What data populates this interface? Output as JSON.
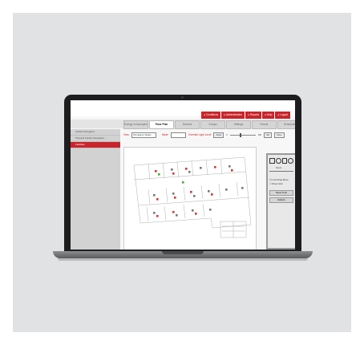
{
  "menu": [
    {
      "icon": "lock-icon",
      "label": "Conditions"
    },
    {
      "icon": "gear-icon",
      "label": "Administration"
    },
    {
      "icon": "report-icon",
      "label": "Reports"
    },
    {
      "icon": "help-icon",
      "label": "Help"
    },
    {
      "icon": "logout-icon",
      "label": "Logout"
    }
  ],
  "tabs": [
    "Energy Consumption",
    "Floor Plan",
    "Devices",
    "Groups",
    "Settings",
    "Events",
    "Schedules"
  ],
  "active_tab_index": 1,
  "sidebar": [
    "Facility Navigation",
    "Physical Facility Navigation",
    "Facilities"
  ],
  "toolbar": {
    "view_label": "View",
    "view_value": "Occupancy Status",
    "mode_label": "Mode",
    "light_label": "Override Light Level",
    "apply": "Apply",
    "slider_min": "0",
    "slider_max": "100",
    "set": "Set",
    "save": "Save"
  },
  "rpanel": {
    "zoom_label": "Zoom",
    "check1": "Lock Drag Move",
    "check2": "Show Grid",
    "btn1": "Reset To Fit",
    "btn2": "Refresh"
  },
  "colors": {
    "accent": "#c9252c"
  }
}
